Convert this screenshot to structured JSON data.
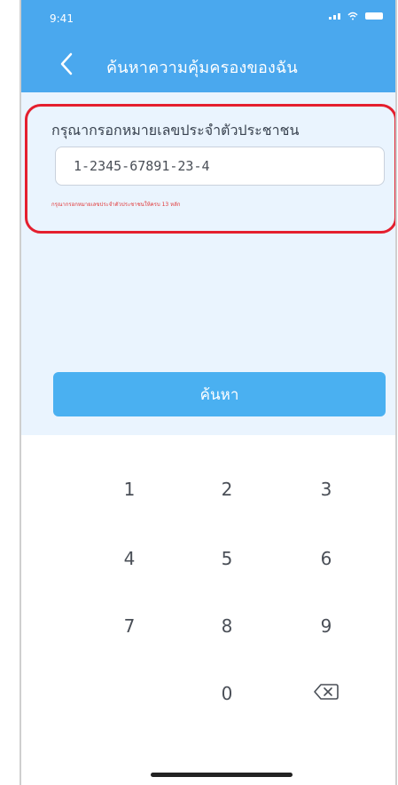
{
  "status_bar": {
    "time": "9:41",
    "icons": [
      "signal-icon",
      "wifi-icon",
      "battery-icon"
    ]
  },
  "header": {
    "title": "ค้นหาความคุ้มครองของฉัน",
    "back_icon": "chevron-left-icon"
  },
  "form": {
    "label": "กรุณากรอกหมายเลขประจำตัวประชาชน",
    "id_value": "1-2345-67891-23-4",
    "error_text": "กรุณากรอกหมายเลขประจำตัวประชาชนให้ครบ 13 หลัก"
  },
  "search_button": {
    "label": "ค้นหา"
  },
  "keypad": {
    "keys": [
      "1",
      "2",
      "3",
      "4",
      "5",
      "6",
      "7",
      "8",
      "9",
      "0"
    ],
    "delete_icon": "backspace-icon"
  },
  "colors": {
    "header": "#4aa8ee",
    "button": "#4ab0f1",
    "highlight": "#e41f2e",
    "error": "#e13636",
    "content_bg": "#eaf4fe"
  }
}
